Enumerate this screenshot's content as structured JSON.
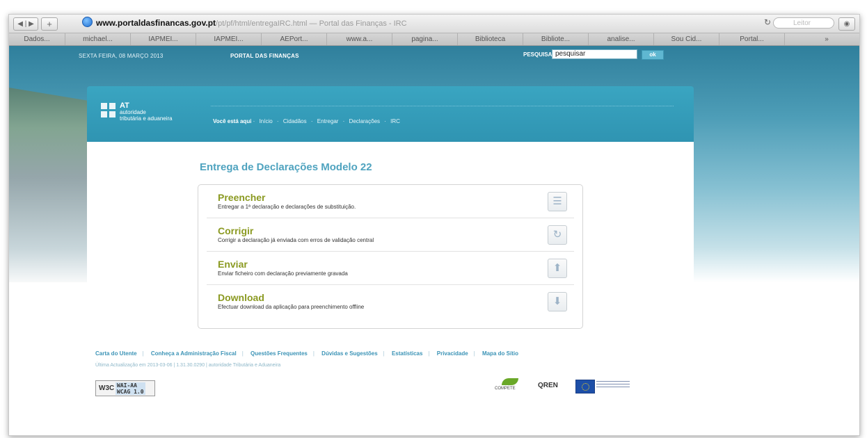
{
  "browser": {
    "url_host": "www.portaldasfinancas.gov.pt",
    "url_path": "/pt/pf/html/entregaIRC.html",
    "page_title_suffix": " — Portal das Finanças - IRC",
    "reader_label": "Leitor",
    "bookmarks": [
      "Dados...",
      "michael...",
      "IAPMEI...",
      "IAPMEI...",
      "AEPort...",
      "www.a...",
      "pagina...",
      "Biblioteca",
      "Bibliote...",
      "analise...",
      "Sou Cid...",
      "Portal...",
      "»"
    ]
  },
  "header": {
    "date": "SEXTA FEIRA, 08 MARÇO 2013",
    "portal": "PORTAL DAS FINANÇAS",
    "search_label": "PESQUISA",
    "search_value": "pesquisar",
    "search_button": "ok"
  },
  "logo": {
    "short": "AT",
    "line1": "autoridade",
    "line2": "tributária e aduaneira"
  },
  "breadcrumb": {
    "label": "Você está aqui",
    "items": [
      "Início",
      "Cidadãos",
      "Entregar",
      "Declarações",
      "IRC"
    ]
  },
  "main": {
    "title": "Entrega de Declarações Modelo 22",
    "options": [
      {
        "title": "Preencher",
        "desc": "Entregar a 1ª declaração e declarações de substituição."
      },
      {
        "title": "Corrigir",
        "desc": "Corrigir a declaração já enviada com erros de validação central"
      },
      {
        "title": "Enviar",
        "desc": "Enviar ficheiro com declaração previamente gravada"
      },
      {
        "title": "Download",
        "desc": "Efectuar download da aplicação para preenchimento offline"
      }
    ]
  },
  "footer": {
    "links": [
      "Carta do Utente",
      "Conheça a Administração Fiscal",
      "Questões Frequentes",
      "Dúvidas e Sugestões",
      "Estatísticas",
      "Privacidade",
      "Mapa do Sítio"
    ],
    "meta": "Última Actualização em 2013-03-06 | 1.31.30.0290 | autoridade Tributária e Aduaneira",
    "badge_w3c": "W3C",
    "badge_line1": "WAI-AA",
    "badge_line2": "WCAG 1.0",
    "compete": "COMPETE",
    "qren": "QREN"
  }
}
